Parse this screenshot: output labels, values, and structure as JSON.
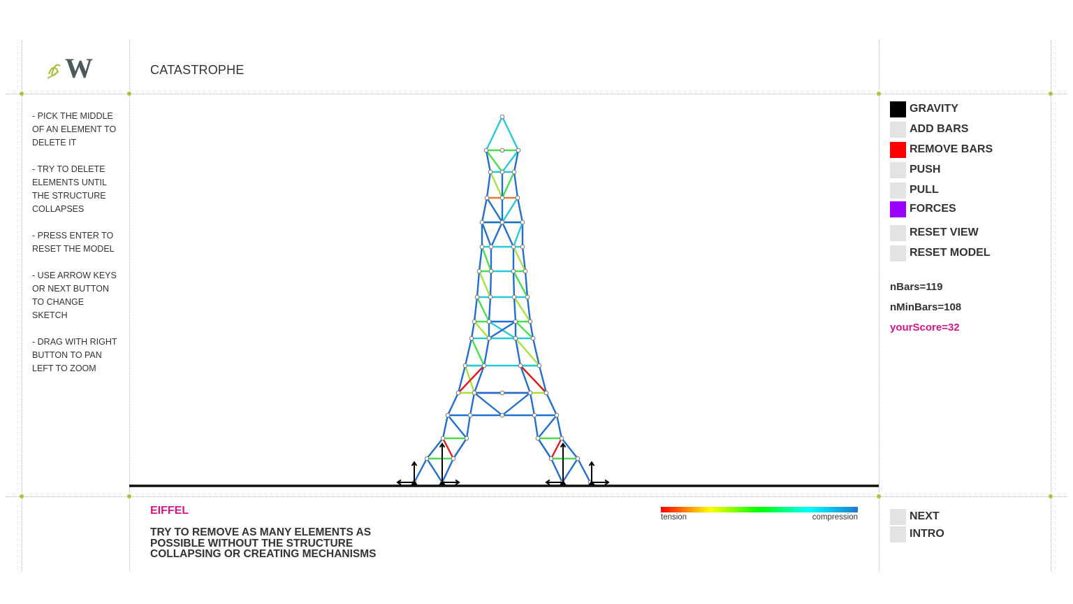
{
  "app": {
    "title": "CATASTROPHE"
  },
  "instructions": [
    "- PICK THE MIDDLE OF AN ELEMENT TO DELETE IT",
    "- TRY TO DELETE ELEMENTS UNTIL THE STRUCTURE COLLAPSES",
    "- PRESS ENTER TO RESET THE MODEL",
    "- USE ARROW KEYS OR NEXT BUTTON TO CHANGE SKETCH",
    "- DRAG WITH RIGHT BUTTON TO PAN LEFT TO ZOOM"
  ],
  "controls": {
    "gravity": {
      "label": "GRAVITY",
      "color": "#000000",
      "active": true
    },
    "add_bars": {
      "label": "ADD BARS",
      "color": "#e3e3e3",
      "active": false
    },
    "remove_bars": {
      "label": "REMOVE BARS",
      "color": "#ff0000",
      "active": true
    },
    "push": {
      "label": "PUSH",
      "color": "#e3e3e3",
      "active": false
    },
    "pull": {
      "label": "PULL",
      "color": "#e3e3e3",
      "active": false
    },
    "forces": {
      "label": "FORCES",
      "color": "#9b00ff",
      "active": true
    },
    "reset_view": {
      "label": "RESET VIEW",
      "color": "#e3e3e3"
    },
    "reset_model": {
      "label": "RESET MODEL",
      "color": "#e3e3e3"
    }
  },
  "stats": {
    "nbars": "nBars=119",
    "nminbars": "nMinBars=108",
    "score": "yourScore=32"
  },
  "sketch": {
    "name": "EIFFEL",
    "message": "TRY TO REMOVE AS MANY ELEMENTS AS POSSIBLE WITHOUT THE STRUCTURE COLLAPSING OR CREATING MECHANISMS"
  },
  "legend": {
    "tension_label": "tension",
    "compression_label": "compression",
    "gradient": [
      "#ff0000",
      "#ffff00",
      "#00ff00",
      "#00ffff",
      "#1f78d1"
    ]
  },
  "nav": {
    "next": {
      "label": "NEXT",
      "color": "#e3e3e3"
    },
    "intro": {
      "label": "INTRO",
      "color": "#e3e3e3"
    }
  },
  "logo": {
    "letter": "W",
    "color": "#4a5a5a",
    "accent": "#a9c23f"
  },
  "colors": {
    "accent_pink": "#d9158a",
    "grid_dot": "#a9c23f",
    "blue": "#1f6fd0",
    "cyan": "#26c9d9",
    "green": "#48e04a",
    "lime": "#a7e23b",
    "red": "#e11b1b",
    "orange": "#e57f2f"
  }
}
